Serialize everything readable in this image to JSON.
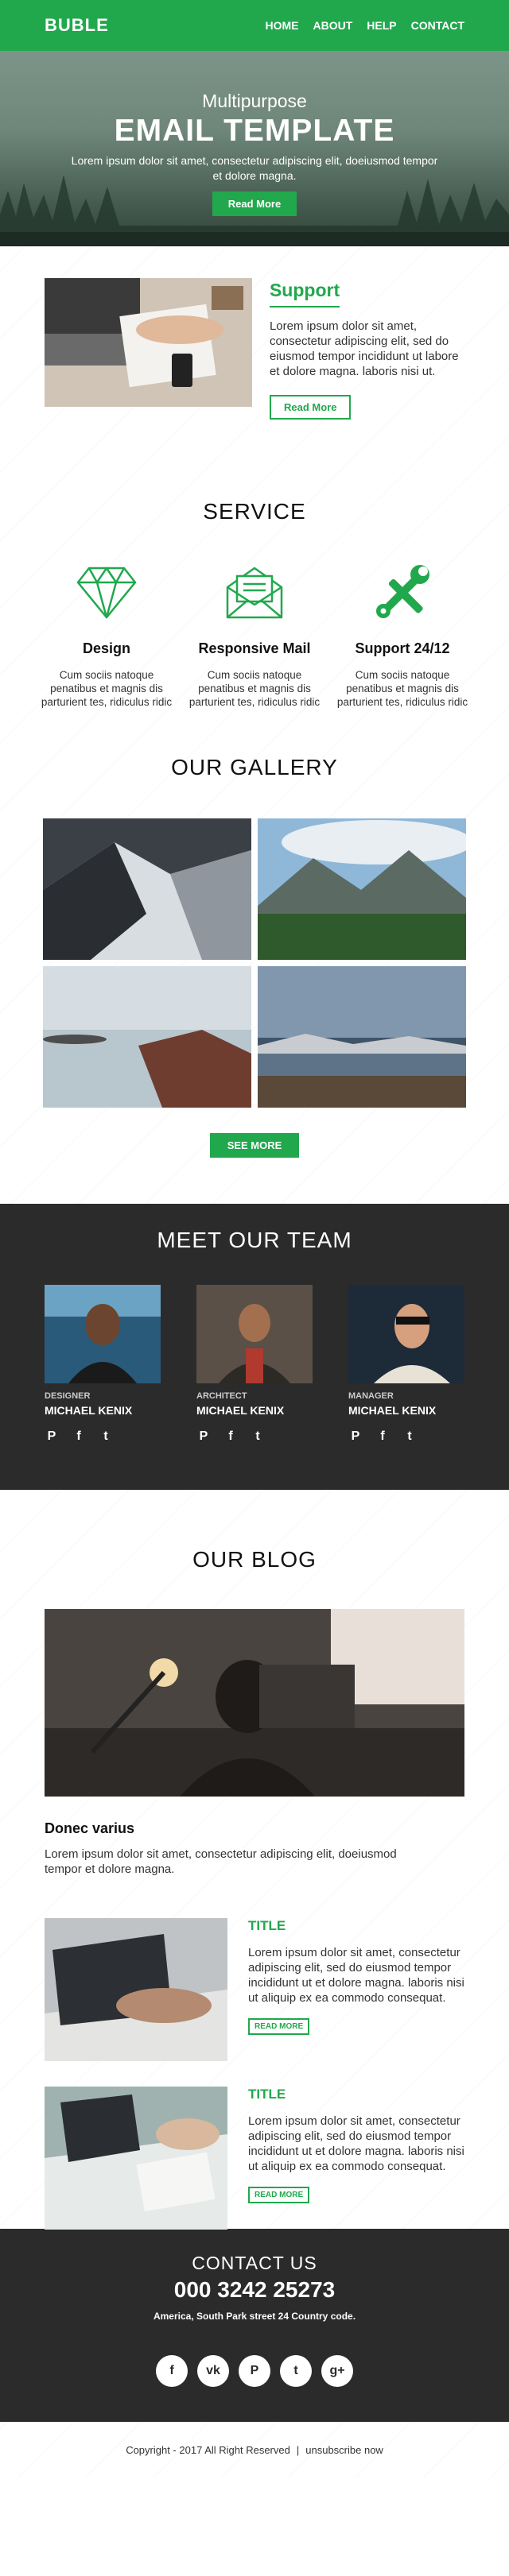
{
  "brand": {
    "logo": "BUBLE",
    "accent": "#21a84d",
    "dark": "#2b2b2b"
  },
  "nav": [
    {
      "label": "HOME"
    },
    {
      "label": "ABOUT"
    },
    {
      "label": "HELP"
    },
    {
      "label": "CONTACT"
    }
  ],
  "hero": {
    "subtitle": "Multipurpose",
    "title": "EMAIL TEMPLATE",
    "text": "Lorem ipsum dolor sit amet, consectetur adipiscing elit, doeiusmod tempor et dolore magna.",
    "button": "Read More"
  },
  "support": {
    "title": "Support",
    "text": "Lorem ipsum dolor sit amet, consectetur adipiscing elit, sed do eiusmod tempor incididunt ut labore et dolore magna. laboris nisi ut.",
    "button": "Read More"
  },
  "service": {
    "title": "SERVICE",
    "items": [
      {
        "icon": "diamond-icon",
        "title": "Design",
        "text": "Cum sociis natoque penatibus et magnis dis parturient tes, ridiculus ridic"
      },
      {
        "icon": "mail-icon",
        "title": "Responsive Mail",
        "text": "Cum sociis natoque penatibus et magnis dis parturient tes, ridiculus ridic"
      },
      {
        "icon": "tools-icon",
        "title": "Support 24/12",
        "text": "Cum sociis natoque penatibus et magnis dis parturient tes, ridiculus ridic"
      }
    ]
  },
  "gallery": {
    "title": "OUR GALLERY",
    "button": "SEE MORE"
  },
  "team": {
    "title": "MEET OUR TEAM",
    "members": [
      {
        "role": "DESIGNER",
        "name": "MICHAEL KENIX"
      },
      {
        "role": "ARCHITECT",
        "name": "MICHAEL KENIX"
      },
      {
        "role": "MANAGER",
        "name": "MICHAEL KENIX"
      }
    ],
    "social_glyphs": [
      "P",
      "f",
      "t"
    ]
  },
  "blog": {
    "title": "OUR BLOG",
    "headline": "Donec varius",
    "headline_text": "Lorem ipsum dolor sit amet, consectetur adipiscing elit, doeiusmod tempor et dolore magna.",
    "posts": [
      {
        "title": "TITLE",
        "text": "Lorem ipsum dolor sit amet, consectetur adipiscing elit, sed do eiusmod tempor incididunt ut et dolore magna. laboris nisi ut aliquip ex ea commodo consequat.",
        "button": "READ MORE"
      },
      {
        "title": "TITLE",
        "text": "Lorem ipsum dolor sit amet, consectetur adipiscing elit, sed do eiusmod tempor incididunt ut et dolore magna. laboris nisi ut aliquip ex ea commodo consequat.",
        "button": "READ MORE"
      }
    ]
  },
  "contact": {
    "title": "CONTACT US",
    "phone": "000 3242 25273",
    "address": "America, South Park street 24 Country code.",
    "socials": [
      {
        "icon": "facebook-icon",
        "glyph": "f"
      },
      {
        "icon": "vk-icon",
        "glyph": "vk"
      },
      {
        "icon": "pinterest-icon",
        "glyph": "P"
      },
      {
        "icon": "twitter-icon",
        "glyph": "t"
      },
      {
        "icon": "googleplus-icon",
        "glyph": "g+"
      }
    ]
  },
  "footer": {
    "copyright": "Copyright - 2017 All Right Reserved",
    "separator": "|",
    "unsubscribe": "unsubscribe now"
  }
}
